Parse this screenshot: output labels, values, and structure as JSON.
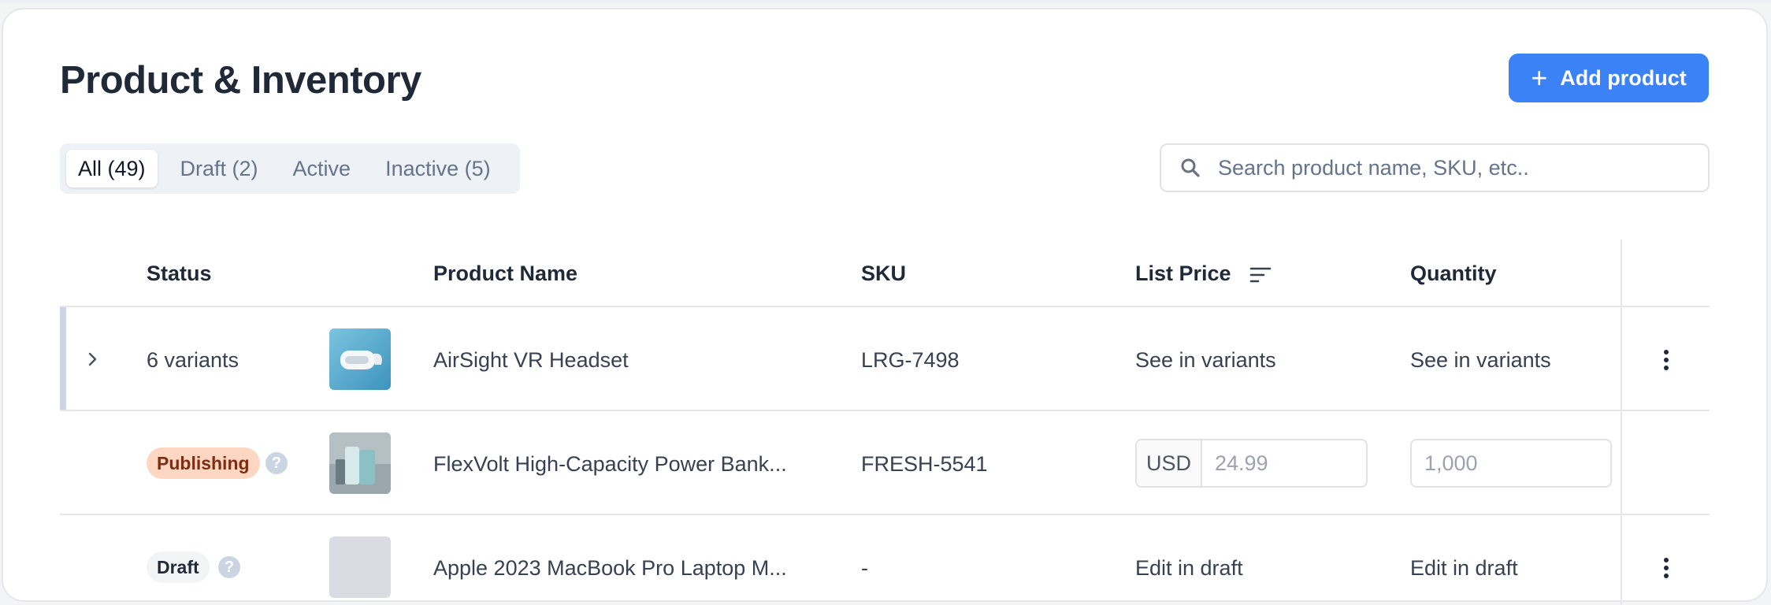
{
  "header": {
    "title": "Product & Inventory",
    "add_button_label": "Add product"
  },
  "tabs": [
    {
      "label": "All (49)",
      "active": true
    },
    {
      "label": "Draft (2)",
      "active": false
    },
    {
      "label": "Active",
      "active": false
    },
    {
      "label": "Inactive (5)",
      "active": false
    }
  ],
  "search": {
    "placeholder": "Search product name, SKU, etc.."
  },
  "table": {
    "columns": {
      "status": "Status",
      "product_name": "Product Name",
      "sku": "SKU",
      "list_price": "List Price",
      "quantity": "Quantity"
    },
    "rows": [
      {
        "status": "6 variants",
        "product_name": "AirSight VR Headset",
        "sku": "LRG-7498",
        "list_price": "See in variants",
        "quantity": "See in variants"
      },
      {
        "status": "Publishing",
        "product_name": "FlexVolt High-Capacity Power Bank...",
        "sku": "FRESH-5541",
        "currency": "USD",
        "price_placeholder": "24.99",
        "quantity_placeholder": "1,000"
      },
      {
        "status": "Draft",
        "product_name": "Apple 2023 MacBook Pro Laptop M...",
        "sku": "-",
        "list_price": "Edit in draft",
        "quantity": "Edit in draft"
      }
    ]
  },
  "help_glyph": "?",
  "colors": {
    "accent": "#3b82f6",
    "publishing_bg": "#fed7c3",
    "publishing_text": "#7c2d12",
    "draft_bg": "#f3f4f6"
  },
  "icons": [
    "plus-icon",
    "search-icon",
    "sort-icon",
    "chevron-right-icon",
    "help-icon",
    "kebab-menu-icon"
  ]
}
